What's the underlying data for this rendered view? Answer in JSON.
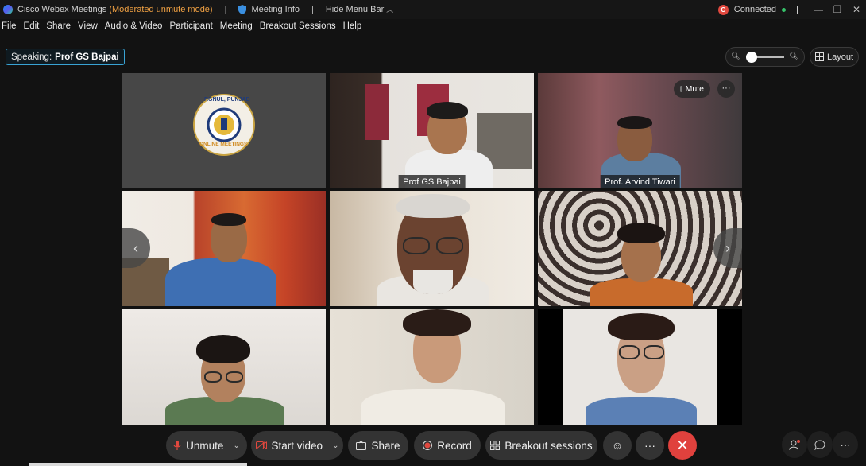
{
  "titlebar": {
    "app_name": "Cisco Webex Meetings",
    "mode": "(Moderated unmute mode)",
    "meeting_info": "Meeting Info",
    "hide_menu": "Hide Menu Bar",
    "status": "Connected",
    "rec_badge": "C",
    "minimize": "—",
    "restore": "❐",
    "close": "✕"
  },
  "menu": [
    "File",
    "Edit",
    "Share",
    "View",
    "Audio & Video",
    "Participant",
    "Meeting",
    "Breakout Sessions",
    "Help"
  ],
  "speaking": {
    "label": "Speaking:",
    "name": "Prof GS Bajpai"
  },
  "zoom": {
    "level": 0.0
  },
  "layout_label": "Layout",
  "tiles": [
    {
      "name": "",
      "type": "logo",
      "logo_top": "RGNUL, PUNJAB",
      "logo_bottom": "ONLINE MEETINGS"
    },
    {
      "name": "Prof GS Bajpai",
      "active": true
    },
    {
      "name": "Prof. Arvind Tiwari",
      "mute_label": "Mute",
      "more": "···"
    },
    {
      "name": ""
    },
    {
      "name": ""
    },
    {
      "name": ""
    },
    {
      "name": ""
    },
    {
      "name": ""
    },
    {
      "name": ""
    }
  ],
  "nav": {
    "prev": "‹",
    "next": "›"
  },
  "toolbar": {
    "unmute": "Unmute",
    "start_video": "Start video",
    "share": "Share",
    "record": "Record",
    "breakout": "Breakout sessions",
    "reactions": "☺",
    "more": "···",
    "leave": "✕",
    "participants": "👤",
    "chat": "💬",
    "right_more": "···"
  },
  "colors": {
    "accent": "#3aa6d8",
    "leave": "#e0413d",
    "mode": "#f0a143",
    "connected": "#36c26a"
  }
}
